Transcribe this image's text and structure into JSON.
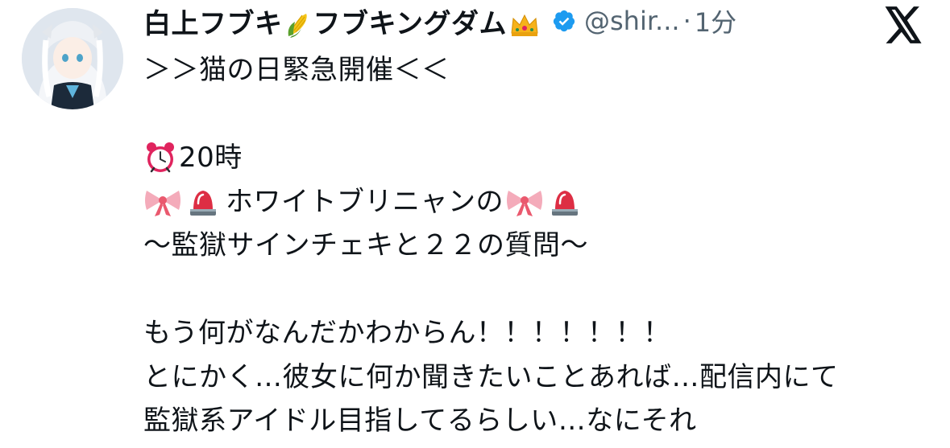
{
  "tweet": {
    "author": {
      "display_name_part1": "白上フブキ",
      "display_name_part2": "フブキングダム",
      "name_emoji_1": "corn-emoji",
      "name_emoji_2": "crown-emoji",
      "verified": true,
      "handle": "@shir...",
      "separator": "·",
      "time": "1分"
    },
    "brand_icon": "x-logo-icon",
    "lines": {
      "l1": "＞＞猫の日緊急開催＜＜",
      "l3": "20時",
      "l4": "ホワイトブリニャンの",
      "l5": "〜監獄サインチェキと２２の質問〜",
      "l7": "もう何がなんだかわからん！！！！！！！",
      "l8": "とにかく…彼女に何か聞きたいことあれば…配信内にて",
      "l9": "監獄系アイドル目指してるらしい…なにそれ"
    },
    "emojis": {
      "alarm_clock": "alarm-clock-emoji",
      "ribbon": "ribbon-emoji",
      "siren": "police-siren-emoji"
    },
    "colors": {
      "text": "#0f1419",
      "secondary": "#536471",
      "verified_blue": "#1d9bf0"
    }
  }
}
